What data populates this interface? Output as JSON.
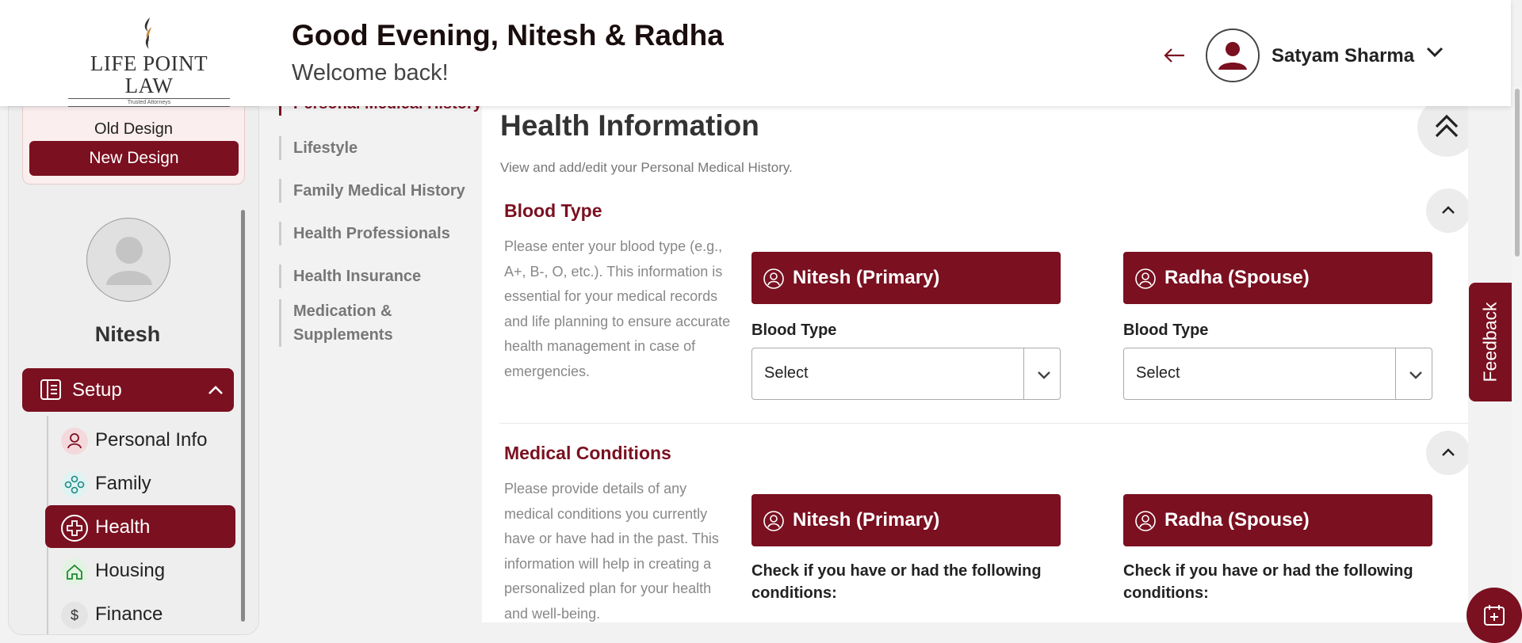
{
  "brand": {
    "name": "LIFE POINT LAW",
    "tagline": "Trusted Attorneys"
  },
  "header": {
    "greeting": "Good Evening, Nitesh & Radha",
    "welcome": "Welcome back!",
    "user_name": "Satyam Sharma"
  },
  "sidebar": {
    "old_design": "Old Design",
    "new_design": "New Design",
    "profile_name": "Nitesh",
    "setup_label": "Setup",
    "items": [
      {
        "label": "Personal Info",
        "icon": "user-icon"
      },
      {
        "label": "Family",
        "icon": "family-icon"
      },
      {
        "label": "Health",
        "icon": "health-cross-icon",
        "active": true
      },
      {
        "label": "Housing",
        "icon": "house-icon"
      },
      {
        "label": "Finance",
        "icon": "dollar-icon"
      }
    ]
  },
  "section_nav": [
    {
      "label": "Personal Medical History",
      "active": true
    },
    {
      "label": "Lifestyle"
    },
    {
      "label": "Family Medical History"
    },
    {
      "label": "Health Professionals"
    },
    {
      "label": "Health Insurance"
    },
    {
      "label": "Medication & Supplements"
    }
  ],
  "main": {
    "title": "Health Information",
    "subtitle": "View and add/edit your Personal Medical History.",
    "blood_type": {
      "title": "Blood Type",
      "description": "Please enter your blood type (e.g., A+, B-, O, etc.). This information is essential for your medical records and life planning to ensure accurate health management in case of emergencies.",
      "primary_label": "Nitesh (Primary)",
      "spouse_label": "Radha (Spouse)",
      "field_label": "Blood Type",
      "primary_value": "Select",
      "spouse_value": "Select"
    },
    "medical_conditions": {
      "title": "Medical Conditions",
      "description": "Please provide details of any medical conditions you currently have or have had in the past. This information will help in creating a personalized plan for your health and well-being.",
      "primary_label": "Nitesh (Primary)",
      "spouse_label": "Radha (Spouse)",
      "check_text": "Check if you have or had the following conditions:"
    }
  },
  "feedback_label": "Feedback",
  "colors": {
    "brand": "#7a1020",
    "background": "#f2f2f2"
  }
}
